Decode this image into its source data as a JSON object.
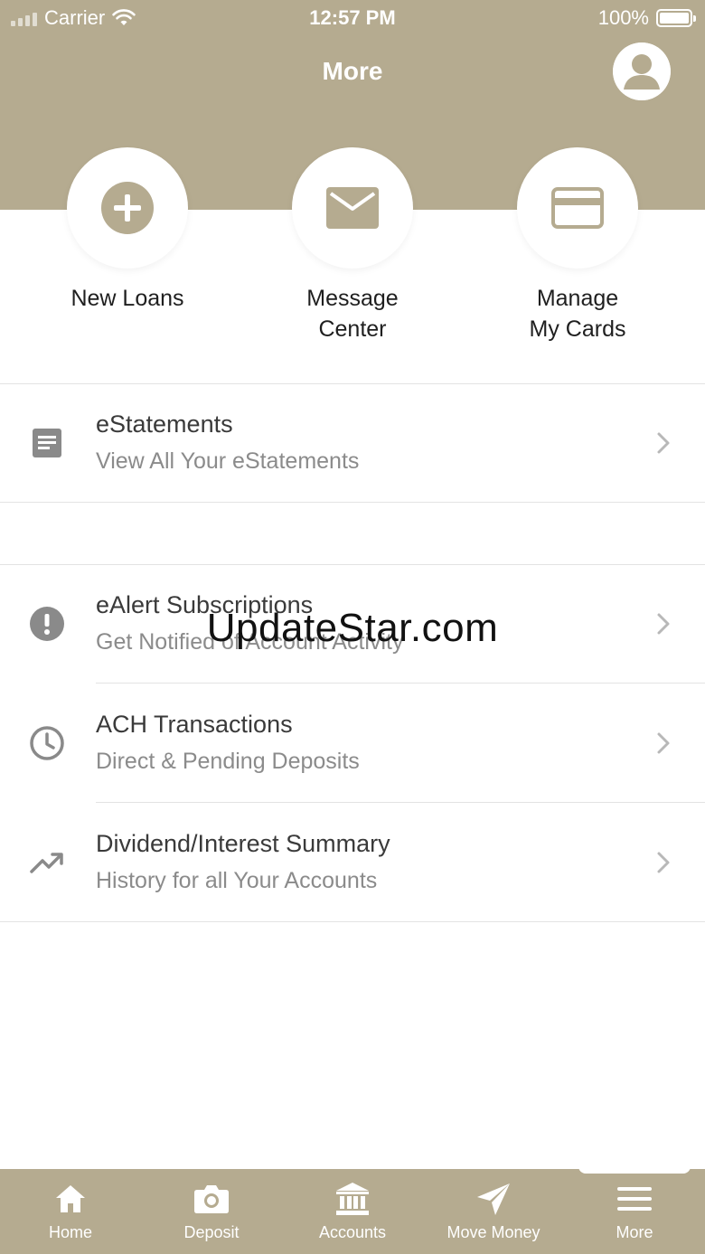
{
  "status_bar": {
    "carrier": "Carrier",
    "time": "12:57 PM",
    "battery": "100%"
  },
  "header": {
    "title": "More"
  },
  "quick_actions": [
    {
      "label": "New Loans",
      "icon": "plus-circle-icon"
    },
    {
      "label": "Message\nCenter",
      "icon": "envelope-icon"
    },
    {
      "label": "Manage\nMy Cards",
      "icon": "credit-card-icon"
    }
  ],
  "menu": [
    {
      "title": "eStatements",
      "subtitle": "View All Your eStatements",
      "icon": "document-icon"
    },
    {
      "title": "eAlert Subscriptions",
      "subtitle": "Get Notified of Account Activity",
      "icon": "alert-icon"
    },
    {
      "title": "ACH Transactions",
      "subtitle": "Direct & Pending Deposits",
      "icon": "clock-icon"
    },
    {
      "title": "Dividend/Interest Summary",
      "subtitle": "History for all Your Accounts",
      "icon": "trending-up-icon"
    }
  ],
  "watermark": "UpdateStar.com",
  "tabs": [
    {
      "label": "Home",
      "icon": "home-icon"
    },
    {
      "label": "Deposit",
      "icon": "camera-icon"
    },
    {
      "label": "Accounts",
      "icon": "bank-icon"
    },
    {
      "label": "Move Money",
      "icon": "paper-plane-icon"
    },
    {
      "label": "More",
      "icon": "menu-icon"
    }
  ],
  "colors": {
    "brand": "#b5ab90",
    "text": "#3a3a3a",
    "subtext": "#8b8b8b",
    "icon": "#8a8a8a"
  }
}
